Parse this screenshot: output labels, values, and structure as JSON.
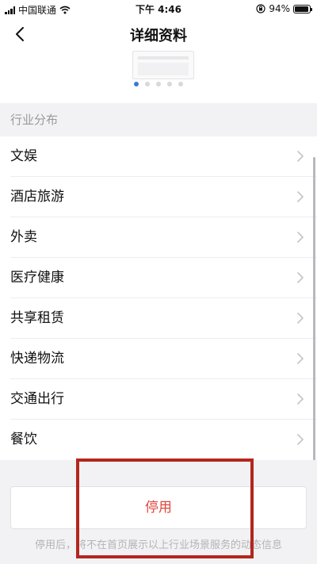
{
  "status_bar": {
    "carrier": "中国联通",
    "time": "下午 4:46",
    "battery_percent": "94%",
    "battery_level": 0.94,
    "icons": [
      "signal-icon",
      "wifi-icon",
      "orientation-lock-icon",
      "battery-icon"
    ]
  },
  "nav": {
    "title": "详细资料",
    "back_icon": "chevron-left-icon"
  },
  "carousel": {
    "page_count": 5,
    "active_index": 0,
    "active_color": "#3a7bd5"
  },
  "section": {
    "header": "行业分布",
    "items": [
      {
        "label": "文娱"
      },
      {
        "label": "酒店旅游"
      },
      {
        "label": "外卖"
      },
      {
        "label": "医疗健康"
      },
      {
        "label": "共享租赁"
      },
      {
        "label": "快递物流"
      },
      {
        "label": "交通出行"
      },
      {
        "label": "餐饮"
      }
    ]
  },
  "footer": {
    "disable_label": "停用",
    "disable_color": "#e0463c",
    "note": "停用后，将不在首页展示以上行业场景服务的动态信息",
    "highlight_color": "#b3261e"
  }
}
